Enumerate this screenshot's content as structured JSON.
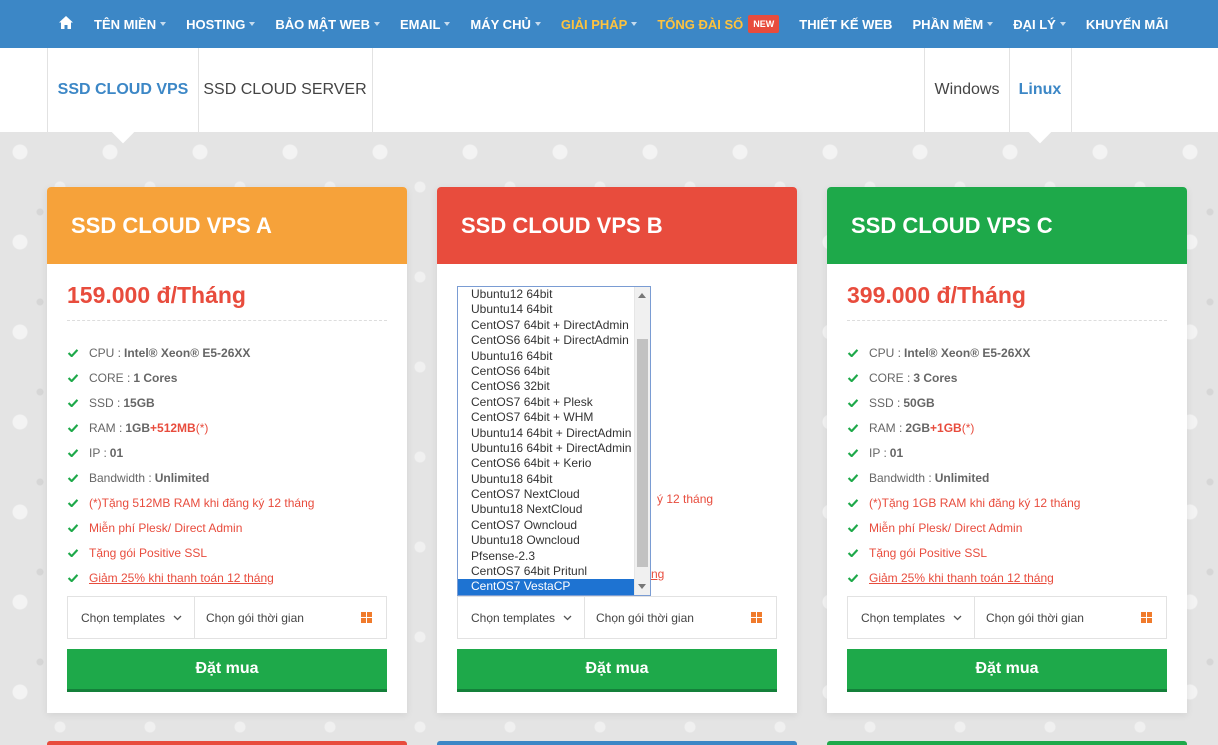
{
  "nav": {
    "items": [
      {
        "label": "TÊN MIỀN",
        "caret": true,
        "gold": false
      },
      {
        "label": "HOSTING",
        "caret": true,
        "gold": false
      },
      {
        "label": "BẢO MẬT WEB",
        "caret": true,
        "gold": false
      },
      {
        "label": "EMAIL",
        "caret": true,
        "gold": false
      },
      {
        "label": "MÁY CHỦ",
        "caret": true,
        "gold": false
      },
      {
        "label": "GIẢI PHÁP",
        "caret": true,
        "gold": true
      },
      {
        "label": "TỔNG ĐÀI SỐ",
        "caret": false,
        "gold": true,
        "badge": "NEW"
      },
      {
        "label": "THIẾT KẾ WEB",
        "caret": false,
        "gold": false
      },
      {
        "label": "PHẦN MỀM",
        "caret": true,
        "gold": false
      },
      {
        "label": "ĐẠI LÝ",
        "caret": true,
        "gold": false
      },
      {
        "label": "KHUYẾN MÃI",
        "caret": false,
        "gold": false
      }
    ],
    "home_icon": "home-icon"
  },
  "tabs": {
    "left": [
      {
        "label": "SSD CLOUD VPS",
        "active": true
      },
      {
        "label": "SSD CLOUD SERVER",
        "active": false
      }
    ],
    "right": [
      {
        "label": "Windows",
        "active": false
      },
      {
        "label": "Linux",
        "active": true
      }
    ]
  },
  "cards": [
    {
      "title": "SSD CLOUD VPS A",
      "color": "#f6a23a",
      "price": "159.000 đ/Tháng",
      "cpu_label": "CPU :",
      "cpu": "Intel® Xeon® E5-26XX",
      "core_label": "CORE :",
      "core": "1 Cores",
      "ssd_label": "SSD :",
      "ssd": "15GB",
      "ram_label": "RAM :",
      "ram": "1GB",
      "ram_plus": "+512MB",
      "ram_star": "(*)",
      "ip_label": "IP :",
      "ip": "01",
      "bw_label": "Bandwidth :",
      "bw": "Unlimited",
      "promo1": "(*)Tặng 512MB RAM khi đăng ký 12 tháng",
      "promo2": "Miễn phí Plesk/ Direct Admin",
      "promo3": "Tặng gói Positive SSL",
      "promo4": "Giảm 25% khi thanh toán 12 tháng",
      "template_label": "Chọn templates",
      "period_label": "Chọn gói thời gian",
      "buy": "Đặt mua"
    },
    {
      "title": "SSD CLOUD VPS B",
      "color": "#e84c3d",
      "template_label": "Chọn templates",
      "period_label": "Chọn gói thời gian",
      "buy": "Đặt mua",
      "visible_promo_tail": "ý 12 tháng",
      "visible_promo_tail2": "ng"
    },
    {
      "title": "SSD CLOUD VPS C",
      "color": "#1ea94a",
      "price": "399.000 đ/Tháng",
      "cpu_label": "CPU :",
      "cpu": "Intel® Xeon® E5-26XX",
      "core_label": "CORE :",
      "core": "3 Cores",
      "ssd_label": "SSD :",
      "ssd": "50GB",
      "ram_label": "RAM :",
      "ram": "2GB",
      "ram_plus": "+1GB",
      "ram_star": "(*)",
      "ip_label": "IP :",
      "ip": "01",
      "bw_label": "Bandwidth :",
      "bw": "Unlimited",
      "promo1": "(*)Tặng 1GB RAM khi đăng ký 12 tháng",
      "promo2": "Miễn phí Plesk/ Direct Admin",
      "promo3": "Tặng gói Positive SSL",
      "promo4": "Giảm 25% khi thanh toán 12 tháng",
      "template_label": "Chọn templates",
      "period_label": "Chọn gói thời gian",
      "buy": "Đặt mua"
    }
  ],
  "template_dropdown": {
    "options": [
      "Ubuntu12 64bit",
      "Ubuntu14 64bit",
      "CentOS7 64bit + DirectAdmin",
      "CentOS6 64bit + DirectAdmin",
      "Ubuntu16 64bit",
      "CentOS6 64bit",
      "CentOS6 32bit",
      "CentOS7 64bit + Plesk",
      "CentOS7 64bit + WHM",
      "Ubuntu14 64bit + DirectAdmin",
      "Ubuntu16 64bit + DirectAdmin",
      "CentOS6 64bit + Kerio",
      "Ubuntu18 64bit",
      "CentOS7 NextCloud",
      "Ubuntu18 NextCloud",
      "CentOS7 Owncloud",
      "Ubuntu18 Owncloud",
      "Pfsense-2.3",
      "CentOS7 64bit Pritunl",
      "CentOS7 VestaCP"
    ],
    "selected": "CentOS7 VestaCP"
  },
  "bottom_strip_colors": [
    "#e84c3d",
    "#3c87c6",
    "#1ea94a"
  ]
}
